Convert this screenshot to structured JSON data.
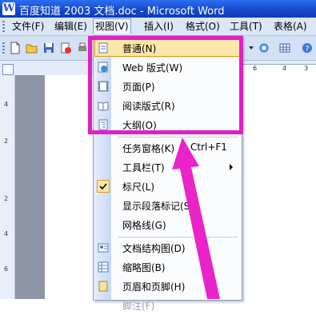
{
  "window": {
    "title": "百度知道 2003 文档.doc - Microsoft Word"
  },
  "menubar": {
    "items": [
      {
        "label": "文件(F)"
      },
      {
        "label": "编辑(E)"
      },
      {
        "label": "视图(V)"
      },
      {
        "label": "插入(I)"
      },
      {
        "label": "格式(O)"
      },
      {
        "label": "工具(T)"
      },
      {
        "label": "表格(A)"
      }
    ]
  },
  "ruler": {
    "h_ticks": [
      "6",
      "4",
      "3"
    ],
    "v_ticks": [
      "4",
      "2",
      "2",
      "4",
      "6"
    ]
  },
  "view_menu": {
    "items": [
      {
        "label": "普通(N)"
      },
      {
        "label": "Web 版式(W)"
      },
      {
        "label": "页面(P)"
      },
      {
        "label": "阅读版式(R)"
      },
      {
        "label": "大纲(O)"
      },
      {
        "label": "任务窗格(K)",
        "shortcut": "Ctrl+F1"
      },
      {
        "label": "工具栏(T)"
      },
      {
        "label": "标尺(L)"
      },
      {
        "label": "显示段落标记(S)"
      },
      {
        "label": "网格线(G)"
      },
      {
        "label": "文档结构图(D)"
      },
      {
        "label": "缩略图(B)"
      },
      {
        "label": "页眉和页脚(H)"
      },
      {
        "label": "脚注(F)"
      }
    ]
  },
  "colors": {
    "highlight_box": "#e020c4",
    "arrow": "#ea24c8",
    "hover": "#fbe8a8"
  }
}
